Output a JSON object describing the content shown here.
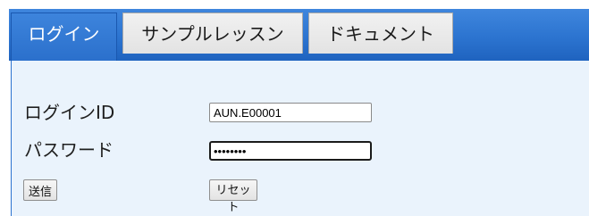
{
  "tabs": {
    "login": "ログイン",
    "sample_lesson": "サンプルレッスン",
    "documents": "ドキュメント"
  },
  "form": {
    "login_id_label": "ログインID",
    "login_id_value": "AUN.E00001",
    "password_label": "パスワード",
    "password_value": "aun00001",
    "submit_label": "送信",
    "reset_label": "リセット"
  },
  "colors": {
    "accent": "#2c74d0",
    "panel_background": "#eaf3fc"
  }
}
